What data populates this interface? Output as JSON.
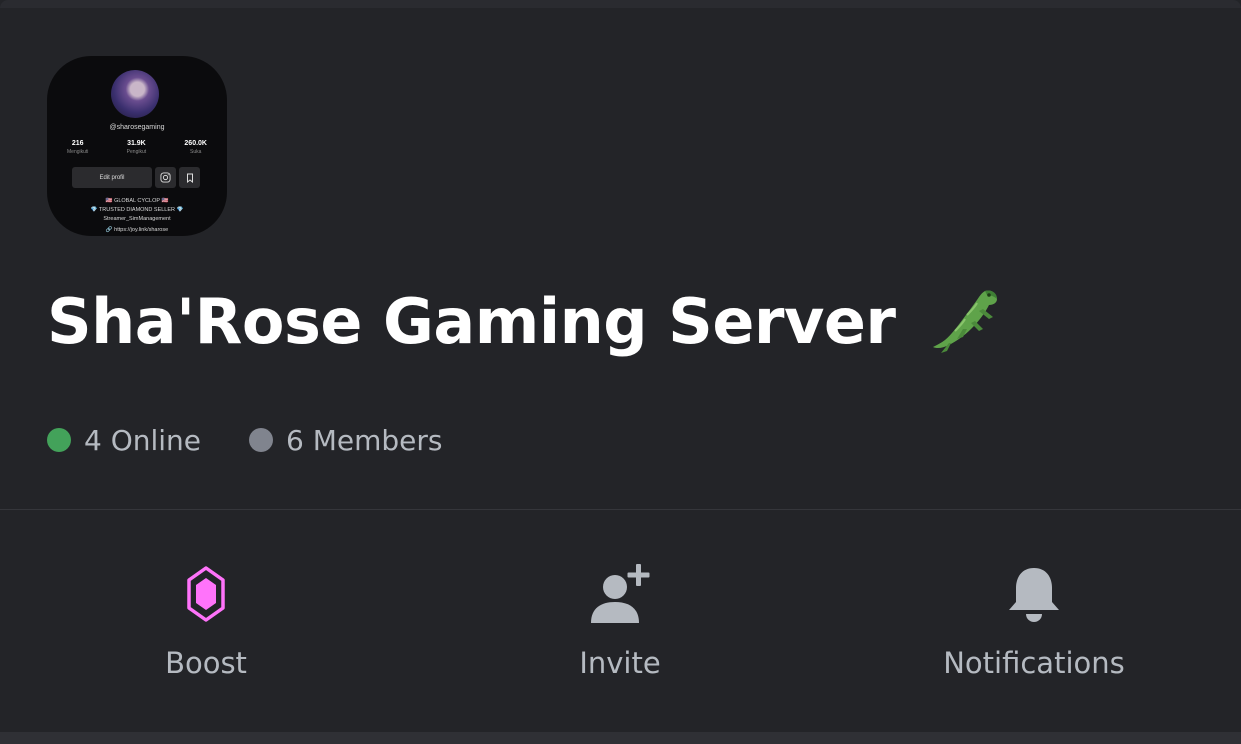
{
  "server": {
    "name": "Sha'Rose Gaming Server",
    "name_emoji": "crocodile-emoji",
    "icon": {
      "handle": "@sharosegaming",
      "stats": [
        {
          "value": "216",
          "label": "Mengikuti"
        },
        {
          "value": "31.9K",
          "label": "Pengikut"
        },
        {
          "value": "260.0K",
          "label": "Suka"
        }
      ],
      "edit_label": "Edit profil",
      "bio_line1": "🇺🇸 GLOBAL CYCLOP 🇺🇸",
      "bio_line2": "💎 TRUSTED DIAMOND SELLER 💎",
      "bio_line3": "Streamer_SimManagement",
      "link": "🔗 https://joy.link/sharose"
    }
  },
  "counts": {
    "online_label": "4 Online",
    "members_label": "6 Members",
    "online_color": "#43a25a",
    "members_color": "#80848e"
  },
  "actions": [
    {
      "label": "Boost",
      "icon": "boost-gem-icon",
      "color": "#ff73fa"
    },
    {
      "label": "Invite",
      "icon": "add-user-icon",
      "color": "#b5bac1"
    },
    {
      "label": "Notifications",
      "icon": "bell-icon",
      "color": "#b5bac1"
    }
  ],
  "colors": {
    "background": "#232428",
    "text_primary": "#ffffff",
    "text_secondary": "#b5bac1"
  }
}
